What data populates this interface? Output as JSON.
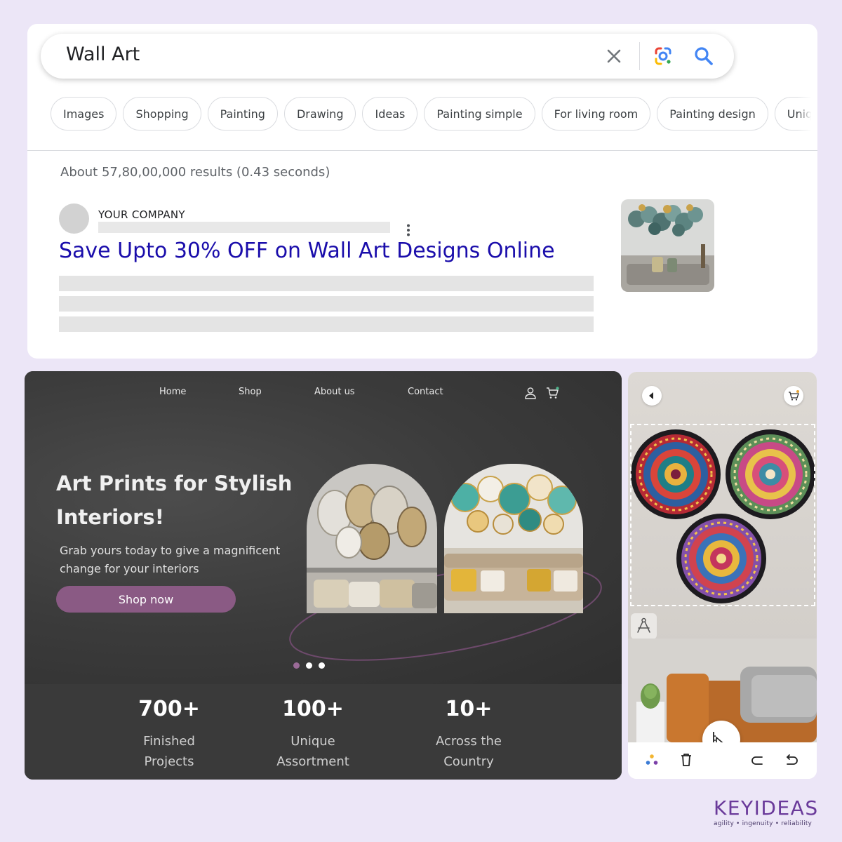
{
  "search": {
    "query": "Wall Art",
    "chips": [
      "Images",
      "Shopping",
      "Painting",
      "Drawing",
      "Ideas",
      "Painting simple",
      "For living room",
      "Painting design",
      "Unique"
    ],
    "result_stats": "About 57,80,00,000 results (0.43 seconds)",
    "result": {
      "company": "YOUR COMPANY",
      "title": "Save Upto 30% OFF on Wall Art Designs Online"
    }
  },
  "hero": {
    "nav": [
      "Home",
      "Shop",
      "About us",
      "Contact"
    ],
    "title": "Art Prints for Stylish Interiors!",
    "subtitle": "Grab yours today to give a magnificent change for your interiors",
    "cta": "Shop now",
    "stats": [
      {
        "value": "700+",
        "label": "Finished Projects"
      },
      {
        "value": "100+",
        "label": "Unique Assortment"
      },
      {
        "value": "10+",
        "label": "Across the Country"
      }
    ]
  },
  "brand": {
    "name": "KEYIDEAS",
    "tagline": "agility  •  ingenuity  •  reliability"
  },
  "colors": {
    "page_bg": "#ece6f7",
    "link_blue": "#1a0dab",
    "hero_bg": "#3a3a3a",
    "cta_purple": "#8a5a84",
    "brand_purple": "#6a3a9a"
  }
}
